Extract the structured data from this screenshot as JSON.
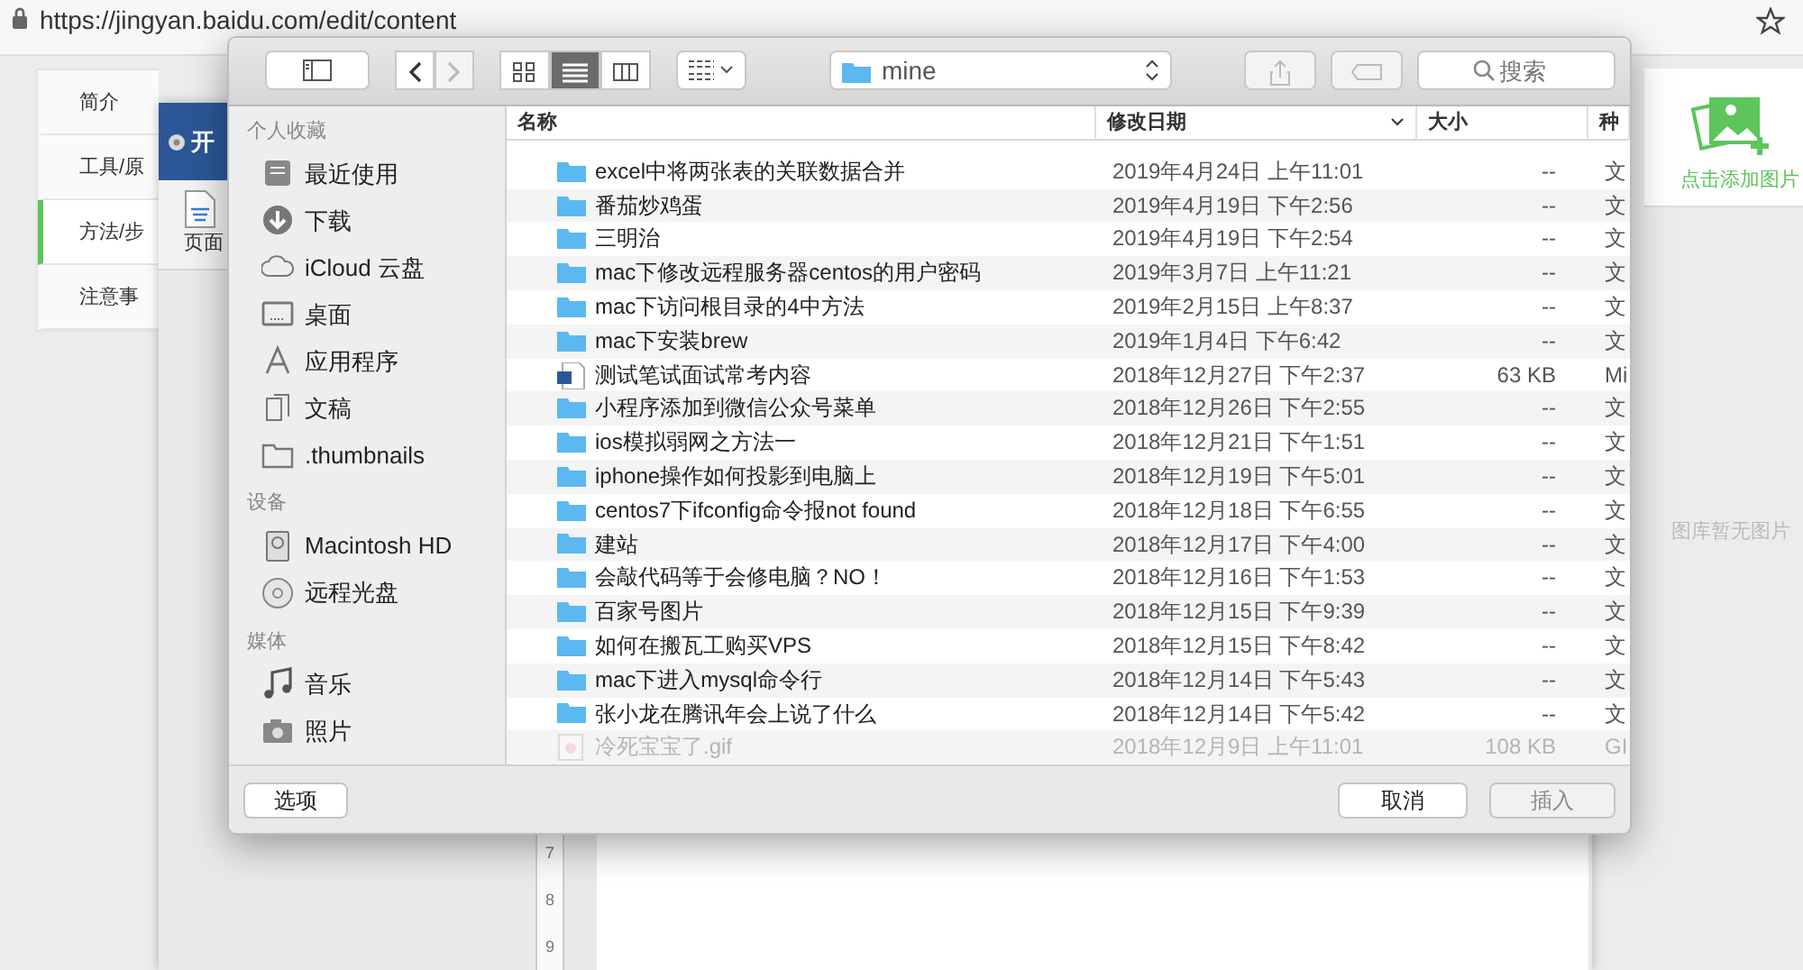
{
  "browser": {
    "url": "https://jingyan.baidu.com/edit/content"
  },
  "page_nav": [
    {
      "label": "简介",
      "selected": false
    },
    {
      "label": "工具/原",
      "selected": false
    },
    {
      "label": "方法/步",
      "selected": true
    },
    {
      "label": "注意事",
      "selected": false
    }
  ],
  "editor_window": {
    "title": "开",
    "item": "页面",
    "ruler": [
      "7",
      "8",
      "9"
    ]
  },
  "image_panel": {
    "add_label": "点击添加图片",
    "empty_text": "图库暂无图片"
  },
  "dialog": {
    "location": "mine",
    "search": {
      "placeholder": "搜索"
    },
    "view_modes": [
      {
        "kind": "icons",
        "selected": false
      },
      {
        "kind": "list",
        "selected": true
      },
      {
        "kind": "columns",
        "selected": false
      }
    ],
    "sidebar": [
      {
        "heading": "个人收藏",
        "items": [
          {
            "label": "最近使用",
            "kind": "recent"
          },
          {
            "label": "下载",
            "kind": "download"
          },
          {
            "label": "iCloud 云盘",
            "kind": "cloud"
          },
          {
            "label": "桌面",
            "kind": "desktop"
          },
          {
            "label": "应用程序",
            "kind": "apps"
          },
          {
            "label": "文稿",
            "kind": "documents"
          },
          {
            "label": ".thumbnails",
            "kind": "folder"
          }
        ]
      },
      {
        "heading": "设备",
        "items": [
          {
            "label": "Macintosh HD",
            "kind": "disk"
          },
          {
            "label": "远程光盘",
            "kind": "disc"
          }
        ]
      },
      {
        "heading": "媒体",
        "items": [
          {
            "label": "音乐",
            "kind": "music"
          },
          {
            "label": "照片",
            "kind": "photos"
          }
        ]
      }
    ],
    "columns": [
      {
        "label": "名称",
        "sorted": false
      },
      {
        "label": "修改日期",
        "sorted": true
      },
      {
        "label": "大小",
        "sorted": false
      },
      {
        "label": "种",
        "sorted": false
      }
    ],
    "rows": [
      {
        "name": "excel中将两张表的关联数据合并",
        "kind": "folder",
        "date": "2019年4月24日 上午11:01",
        "size": "--",
        "type": "文",
        "disabled": false
      },
      {
        "name": "番茄炒鸡蛋",
        "kind": "folder",
        "date": "2019年4月19日 下午2:56",
        "size": "--",
        "type": "文",
        "disabled": false
      },
      {
        "name": "三明治",
        "kind": "folder",
        "date": "2019年4月19日 下午2:54",
        "size": "--",
        "type": "文",
        "disabled": false
      },
      {
        "name": "mac下修改远程服务器centos的用户密码",
        "kind": "folder",
        "date": "2019年3月7日 上午11:21",
        "size": "--",
        "type": "文",
        "disabled": false
      },
      {
        "name": "mac下访问根目录的4中方法",
        "kind": "folder",
        "date": "2019年2月15日 上午8:37",
        "size": "--",
        "type": "文",
        "disabled": false
      },
      {
        "name": "mac下安装brew",
        "kind": "folder",
        "date": "2019年1月4日 下午6:42",
        "size": "--",
        "type": "文",
        "disabled": false
      },
      {
        "name": "测试笔试面试常考内容",
        "kind": "word",
        "date": "2018年12月27日 下午2:37",
        "size": "63 KB",
        "type": "Mi",
        "disabled": false
      },
      {
        "name": "小程序添加到微信公众号菜单",
        "kind": "folder",
        "date": "2018年12月26日 下午2:55",
        "size": "--",
        "type": "文",
        "disabled": false
      },
      {
        "name": "ios模拟弱网之方法一",
        "kind": "folder",
        "date": "2018年12月21日 下午1:51",
        "size": "--",
        "type": "文",
        "disabled": false
      },
      {
        "name": "iphone操作如何投影到电脑上",
        "kind": "folder",
        "date": "2018年12月19日 下午5:01",
        "size": "--",
        "type": "文",
        "disabled": false
      },
      {
        "name": "centos7下ifconfig命令报not found",
        "kind": "folder",
        "date": "2018年12月18日 下午6:55",
        "size": "--",
        "type": "文",
        "disabled": false
      },
      {
        "name": "建站",
        "kind": "folder",
        "date": "2018年12月17日 下午4:00",
        "size": "--",
        "type": "文",
        "disabled": false
      },
      {
        "name": "会敲代码等于会修电脑？NO！",
        "kind": "folder",
        "date": "2018年12月16日 下午1:53",
        "size": "--",
        "type": "文",
        "disabled": false
      },
      {
        "name": "百家号图片",
        "kind": "folder",
        "date": "2018年12月15日 下午9:39",
        "size": "--",
        "type": "文",
        "disabled": false
      },
      {
        "name": "如何在搬瓦工购买VPS",
        "kind": "folder",
        "date": "2018年12月15日 下午8:42",
        "size": "--",
        "type": "文",
        "disabled": false
      },
      {
        "name": "mac下进入mysql命令行",
        "kind": "folder",
        "date": "2018年12月14日 下午5:43",
        "size": "--",
        "type": "文",
        "disabled": false
      },
      {
        "name": "张小龙在腾讯年会上说了什么",
        "kind": "folder",
        "date": "2018年12月14日 下午5:42",
        "size": "--",
        "type": "文",
        "disabled": false
      },
      {
        "name": "冷死宝宝了.gif",
        "kind": "image",
        "date": "2018年12月9日 上午11:01",
        "size": "108 KB",
        "type": "GI",
        "disabled": true
      }
    ],
    "buttons": [
      {
        "label": "选项",
        "disabled": false
      },
      {
        "label": "取消",
        "disabled": false
      },
      {
        "label": "插入",
        "disabled": true
      }
    ]
  }
}
